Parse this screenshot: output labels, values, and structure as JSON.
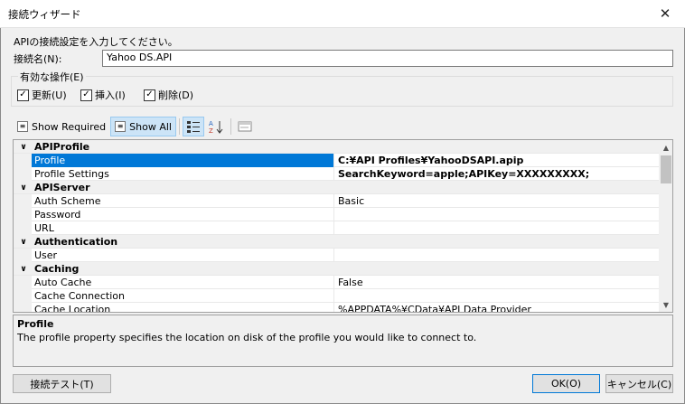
{
  "window": {
    "title": "接続ウィザード",
    "close_glyph": "✕"
  },
  "instruction": "APIの接続設定を入力してください。",
  "connection": {
    "label": "接続名(N):",
    "value": "Yahoo DS.API"
  },
  "operations": {
    "label": "有効な操作(E)",
    "items": [
      {
        "label": "更新(U)",
        "checked": true
      },
      {
        "label": "挿入(I)",
        "checked": true
      },
      {
        "label": "削除(D)",
        "checked": true
      }
    ]
  },
  "toolbar": {
    "show_required": "Show Required",
    "show_all": "Show All",
    "categorized_icon": "categorized-icon",
    "sort_az_icon": "sort-az-icon",
    "property_pages_icon": "property-pages-icon"
  },
  "grid": {
    "rows": [
      {
        "type": "category",
        "name": "APIProfile",
        "expand": "∨"
      },
      {
        "type": "property",
        "name": "Profile",
        "value": "C:¥API Profiles¥YahooDSAPI.apip",
        "bold": true,
        "selected": true
      },
      {
        "type": "property",
        "name": "Profile Settings",
        "value": "SearchKeyword=apple;APIKey=XXXXXXXXX;",
        "bold": true
      },
      {
        "type": "category",
        "name": "APIServer",
        "expand": "∨"
      },
      {
        "type": "property",
        "name": "Auth Scheme",
        "value": "Basic"
      },
      {
        "type": "property",
        "name": "Password",
        "value": ""
      },
      {
        "type": "property",
        "name": "URL",
        "value": ""
      },
      {
        "type": "category",
        "name": "Authentication",
        "expand": "∨"
      },
      {
        "type": "property",
        "name": "User",
        "value": ""
      },
      {
        "type": "category",
        "name": "Caching",
        "expand": "∨"
      },
      {
        "type": "property",
        "name": "Auto Cache",
        "value": "False"
      },
      {
        "type": "property",
        "name": "Cache Connection",
        "value": ""
      },
      {
        "type": "property",
        "name": "Cache Location",
        "value": "%APPDATA%¥CData¥API Data Provider"
      }
    ]
  },
  "help": {
    "title": "Profile",
    "text": "The profile property specifies the location on disk of the profile you would like to connect to."
  },
  "buttons": {
    "test": "接続テスト(T)",
    "ok": "OK(O)",
    "cancel": "キャンセル(C)"
  },
  "colors": {
    "selection": "#0078d7",
    "toggle_active": "#cce4f7"
  }
}
